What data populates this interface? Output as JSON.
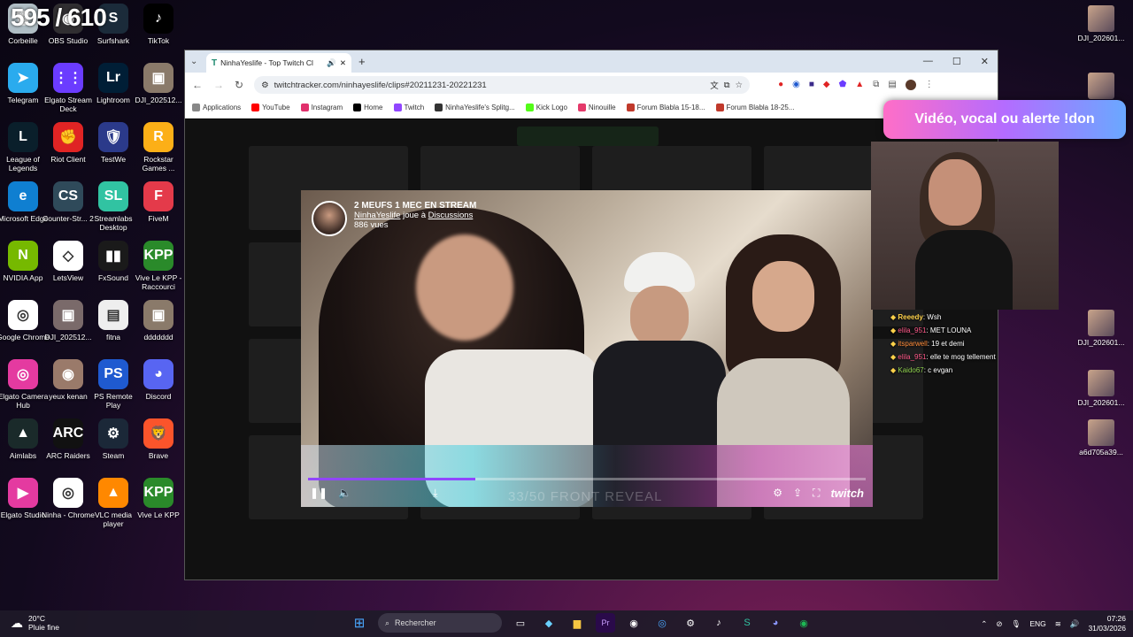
{
  "counter": "595 / 610",
  "desktop_icons": [
    {
      "label": "Corbeille",
      "color": "#b0bec5",
      "glyph": "🗑"
    },
    {
      "label": "OBS Studio",
      "color": "#302e31",
      "glyph": "◉"
    },
    {
      "label": "Surfshark",
      "color": "#1b2b3a",
      "glyph": "S"
    },
    {
      "label": "TikTok",
      "color": "#000000",
      "glyph": "♪"
    },
    {
      "label": "Telegram",
      "color": "#2aabee",
      "glyph": "➤"
    },
    {
      "label": "Elgato Stream Deck",
      "color": "#6b3cff",
      "glyph": "⋮⋮"
    },
    {
      "label": "Lightroom",
      "color": "#001e36",
      "glyph": "Lr"
    },
    {
      "label": "DJI_202512...",
      "color": "#8a7a6a",
      "glyph": "▣"
    },
    {
      "label": "League of Legends",
      "color": "#0a1f2b",
      "glyph": "L"
    },
    {
      "label": "Riot Client",
      "color": "#e02424",
      "glyph": "✊"
    },
    {
      "label": "TestWe",
      "color": "#2b3a8a",
      "glyph": "🛡"
    },
    {
      "label": "Rockstar Games ...",
      "color": "#fcaf17",
      "glyph": "R"
    },
    {
      "label": "Microsoft Edge",
      "color": "#0f7fd1",
      "glyph": "e"
    },
    {
      "label": "Counter-Str... 2",
      "color": "#2f4a5a",
      "glyph": "CS"
    },
    {
      "label": "Streamlabs Desktop",
      "color": "#31c3a2",
      "glyph": "SL"
    },
    {
      "label": "FiveM",
      "color": "#e43a4a",
      "glyph": "F"
    },
    {
      "label": "NVIDIA App",
      "color": "#76b900",
      "glyph": "N"
    },
    {
      "label": "LetsView",
      "color": "#ffffff",
      "glyph": "◇"
    },
    {
      "label": "FxSound",
      "color": "#1a1a1a",
      "glyph": "▮▮"
    },
    {
      "label": "Vive Le KPP - Raccourci",
      "color": "#2a8a2a",
      "glyph": "KPP"
    },
    {
      "label": "Google Chrome",
      "color": "#ffffff",
      "glyph": "◎"
    },
    {
      "label": "DJI_202512...",
      "color": "#7a6a6a",
      "glyph": "▣"
    },
    {
      "label": "fitna",
      "color": "#eeeeee",
      "glyph": "▤"
    },
    {
      "label": "ddddddd",
      "color": "#8a7a6a",
      "glyph": "▣"
    },
    {
      "label": "Elgato Camera Hub",
      "color": "#e43aa0",
      "glyph": "◎"
    },
    {
      "label": "yeux kenan",
      "color": "#9a7a6a",
      "glyph": "◉"
    },
    {
      "label": "PS Remote Play",
      "color": "#1f5ad0",
      "glyph": "PS"
    },
    {
      "label": "Discord",
      "color": "#5865f2",
      "glyph": "◕"
    },
    {
      "label": "Aimlabs",
      "color": "#1a2a2a",
      "glyph": "▲"
    },
    {
      "label": "ARC Raiders",
      "color": "#111111",
      "glyph": "ARC"
    },
    {
      "label": "Steam",
      "color": "#1b2838",
      "glyph": "⚙"
    },
    {
      "label": "Brave",
      "color": "#fb542b",
      "glyph": "🦁"
    },
    {
      "label": "Elgato Studio",
      "color": "#e43aa0",
      "glyph": "▶"
    },
    {
      "label": "Ninha - Chrome",
      "color": "#ffffff",
      "glyph": "◎"
    },
    {
      "label": "VLC media player",
      "color": "#ff8800",
      "glyph": "▲"
    },
    {
      "label": "Vive Le KPP",
      "color": "#2a8a2a",
      "glyph": "KPP"
    }
  ],
  "right_icons": [
    "DJI_202601...",
    "DJI_202601...",
    "DJI_202601...",
    "DJI_202601...",
    "a6d705a39..."
  ],
  "browser": {
    "tab_title": "NinhaYeslife - Top Twitch Cl",
    "url": "twitchtracker.com/ninhayeslife/clips#20211231-20221231",
    "bookmarks": [
      {
        "label": "Applications",
        "color": "#888888"
      },
      {
        "label": "YouTube",
        "color": "#ff0000"
      },
      {
        "label": "Instagram",
        "color": "#e1306c"
      },
      {
        "label": "Home",
        "color": "#000000"
      },
      {
        "label": "Twitch",
        "color": "#9146ff"
      },
      {
        "label": "NinhaYeslife's Splitg...",
        "color": "#333333"
      },
      {
        "label": "Kick Logo",
        "color": "#53fc18"
      },
      {
        "label": "Ninouille",
        "color": "#e43a6a"
      },
      {
        "label": "Forum Blabla 15-18...",
        "color": "#c0392b"
      },
      {
        "label": "Forum Blabla 18-25...",
        "color": "#c0392b"
      }
    ]
  },
  "video": {
    "title": "2 MEUFS 1 MEC EN STREAM",
    "channel": "NinhaYeslife",
    "plays_text": "joue à",
    "game": "Discussions",
    "views": "886 vues",
    "progress": 0.3,
    "under_title": "33/50 FRONT REVEAL",
    "brand": "twitch"
  },
  "overlay": {
    "don_button": "Vidéo, vocal ou alerte !don"
  },
  "chat": [
    {
      "user": "Reeedy",
      "msg": "Wsh",
      "ucls": "u1"
    },
    {
      "user": "elila_951",
      "msg": "MET LOUNA",
      "ucls": "u2"
    },
    {
      "user": "itsparwell",
      "msg": "19 et demi",
      "ucls": "u3"
    },
    {
      "user": "elila_951",
      "msg": "elle te mog tellement",
      "ucls": "u2"
    },
    {
      "user": "Kaido67",
      "msg": "c evgan",
      "ucls": "u4"
    }
  ],
  "taskbar": {
    "temp": "20°C",
    "weather": "Pluie fine",
    "search": "Rechercher",
    "lang": "ENG",
    "time": "07:26",
    "date": "31/03/2026"
  }
}
